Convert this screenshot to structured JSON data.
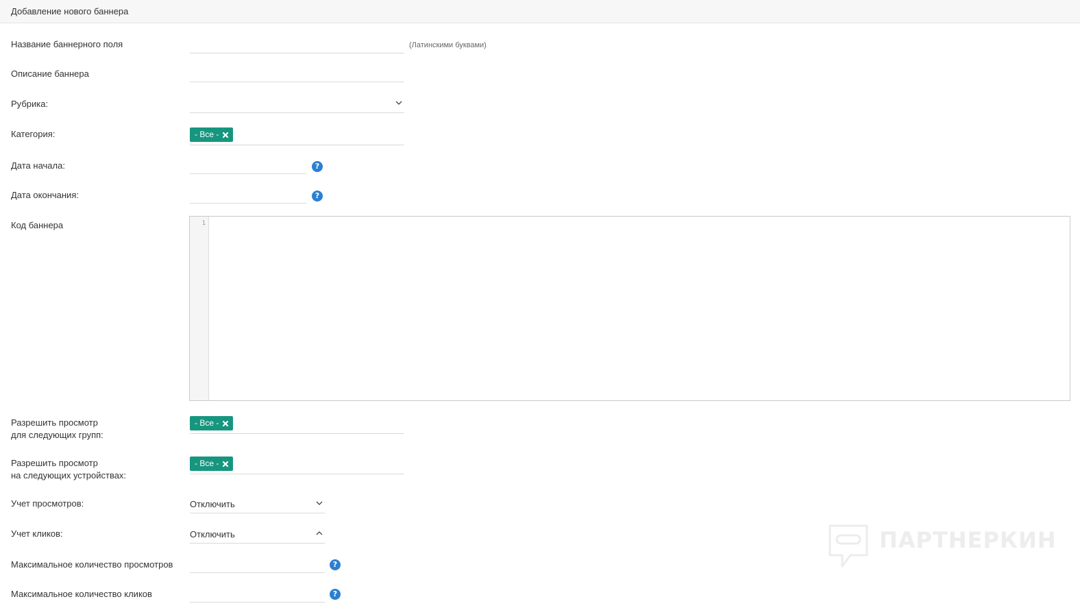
{
  "header": {
    "title": "Добавление нового баннера"
  },
  "form": {
    "banner_name": {
      "label": "Название баннерного поля",
      "value": "",
      "hint": "(Латинскими буквами)"
    },
    "banner_description": {
      "label": "Описание баннера",
      "value": ""
    },
    "rubric": {
      "label": "Рубрика:",
      "value": ""
    },
    "category": {
      "label": "Категория:",
      "tag": "- Все -"
    },
    "start_date": {
      "label": "Дата начала:",
      "value": ""
    },
    "end_date": {
      "label": "Дата окончания:",
      "value": ""
    },
    "banner_code": {
      "label": "Код баннера",
      "line_number": "1"
    },
    "allow_groups": {
      "label_line1": "Разрешить просмотр",
      "label_line2": "для следующих групп:",
      "tag": "- Все -"
    },
    "allow_devices": {
      "label_line1": "Разрешить просмотр",
      "label_line2": "на следующих устройствах:",
      "tag": "- Все -"
    },
    "view_tracking": {
      "label": "Учет просмотров:",
      "value": "Отключить"
    },
    "click_tracking": {
      "label": "Учет кликов:",
      "value": "Отключить"
    },
    "max_views": {
      "label": "Максимальное количество просмотров",
      "value": ""
    },
    "max_clicks": {
      "label": "Максимальное количество кликов",
      "value": ""
    }
  },
  "help_glyph": "?",
  "watermark": {
    "text": "ПАРТНЕРКИН"
  },
  "colors": {
    "tag_bg": "#17967f",
    "help_bg": "#2c7fd1"
  }
}
